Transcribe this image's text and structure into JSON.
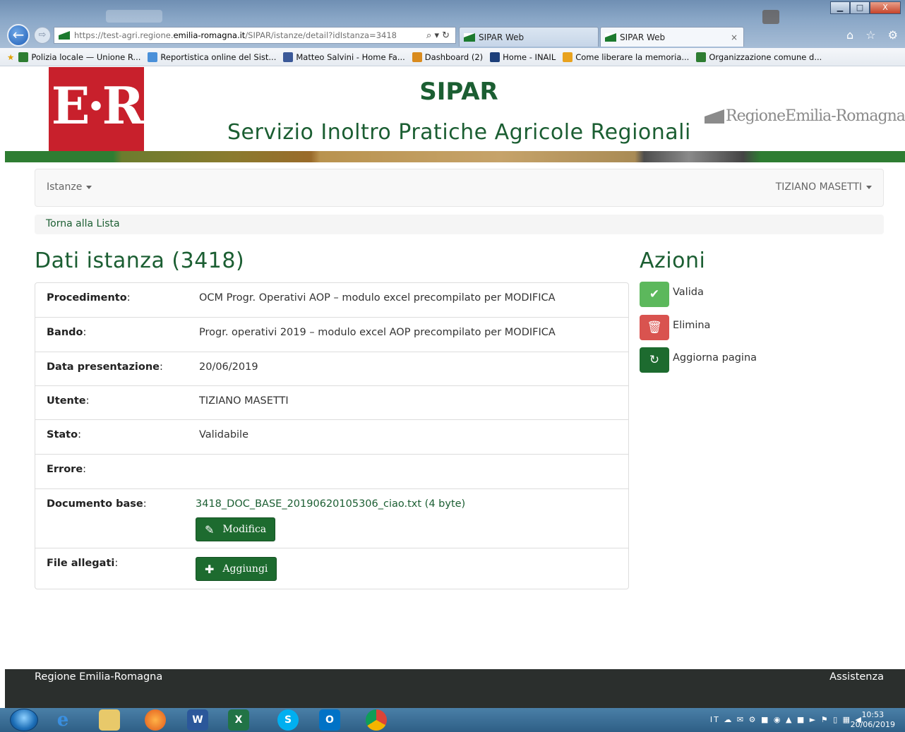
{
  "browser": {
    "url_prefix": "https://test-agri.regione.",
    "url_host": "emilia-romagna.it",
    "url_path": "/SIPAR/istanze/detail?idIstanza=3418",
    "tools": "⌕ ▾ ↻",
    "tabs": [
      {
        "label": "SIPAR Web"
      },
      {
        "label": "SIPAR Web",
        "close": "×"
      }
    ],
    "window_buttons": {
      "minimize": "▁",
      "maximize": "□",
      "close": "X"
    },
    "nav_icons": "⌂ ☆ ⚙",
    "favorites": [
      {
        "label": "Polizia locale — Unione R...",
        "color": "#2e7d32"
      },
      {
        "label": "Reportistica online del Sist...",
        "color": "#4a90d9"
      },
      {
        "label": "Matteo Salvini - Home Fa...",
        "color": "#3b5998"
      },
      {
        "label": "Dashboard (2)",
        "color": "#d98b1e"
      },
      {
        "label": "Home - INAIL",
        "color": "#1d3f7a"
      },
      {
        "label": "Come liberare la memoria...",
        "color": "#e8a21e"
      },
      {
        "label": "Organizzazione comune d...",
        "color": "#2e7d32"
      }
    ]
  },
  "header": {
    "logo_text": "E·R",
    "title": "SIPAR",
    "subtitle": "Servizio Inoltro Pratiche Agricole Regionali",
    "region_logo": "RegioneEmilia-Romagna"
  },
  "navbar": {
    "menu_label": "Istanze",
    "user_label": "TIZIANO MASETTI"
  },
  "breadcrumb": {
    "back_label": "Torna alla Lista"
  },
  "detail": {
    "title": "Dati istanza (3418)",
    "rows": [
      {
        "label": "Procedimento",
        "value": "OCM Progr. Operativi AOP – modulo excel precompilato per MODIFICA"
      },
      {
        "label": "Bando",
        "value": "Progr. operativi 2019 – modulo excel AOP precompilato per MODIFICA"
      },
      {
        "label": "Data presentazione",
        "value": "20/06/2019"
      },
      {
        "label": "Utente",
        "value": "TIZIANO MASETTI"
      },
      {
        "label": "Stato",
        "value": "Validabile"
      },
      {
        "label": "Errore",
        "value": ""
      },
      {
        "label": "Documento base",
        "value": "3418_DOC_BASE_20190620105306_ciao.txt (4 byte)",
        "button": "Modifica"
      },
      {
        "label": "File allegati",
        "value": "",
        "button": "Aggiungi"
      }
    ],
    "colon": ":"
  },
  "actions": {
    "title": "Azioni",
    "items": [
      {
        "label": "Valida",
        "icon": "check-icon"
      },
      {
        "label": "Elimina",
        "icon": "trash-icon"
      },
      {
        "label": "Aggiorna pagina",
        "icon": "refresh-icon"
      }
    ]
  },
  "footer": {
    "left": "Regione Emilia-Romagna",
    "right": "Assistenza"
  },
  "taskbar": {
    "lang": "IT",
    "time": "10:53",
    "date": "20/06/2019"
  },
  "colors": {
    "brand_green": "#1b5e32",
    "button_green": "#1d6b2f",
    "success": "#5cb85c",
    "danger": "#d9534f",
    "logo_red": "#c8202c"
  }
}
